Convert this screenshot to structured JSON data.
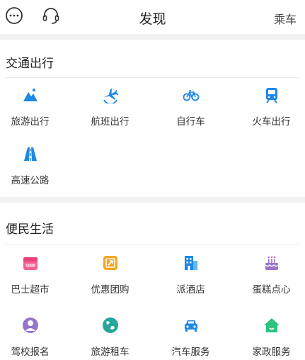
{
  "header": {
    "title": "发现",
    "right_label": "乘车",
    "left_icons": [
      "chat-bubble-icon",
      "headset-icon"
    ]
  },
  "colors": {
    "accent_blue": "#1e88e5",
    "pink": "#f06292",
    "orange": "#f5a623",
    "purple": "#9575cd",
    "teal": "#26a69a",
    "green": "#2ec27e"
  },
  "transport": {
    "title": "交通出行",
    "items": [
      {
        "label": "旅游出行",
        "icon": "mountain-icon"
      },
      {
        "label": "航班出行",
        "icon": "airplane-icon"
      },
      {
        "label": "自行车",
        "icon": "bicycle-icon"
      },
      {
        "label": "火车出行",
        "icon": "train-icon"
      },
      {
        "label": "高速公路",
        "icon": "highway-icon"
      }
    ]
  },
  "life": {
    "title": "便民生活",
    "items": [
      {
        "label": "巴士超市",
        "icon": "shop-icon"
      },
      {
        "label": "优惠团购",
        "icon": "coupon-icon"
      },
      {
        "label": "派酒店",
        "icon": "hotel-icon"
      },
      {
        "label": "蛋糕点心",
        "icon": "cake-icon"
      },
      {
        "label": "驾校报名",
        "icon": "driver-icon"
      },
      {
        "label": "旅游租车",
        "icon": "globe-icon"
      },
      {
        "label": "汽车服务",
        "icon": "car-icon"
      },
      {
        "label": "家政服务",
        "icon": "home-icon"
      }
    ]
  }
}
